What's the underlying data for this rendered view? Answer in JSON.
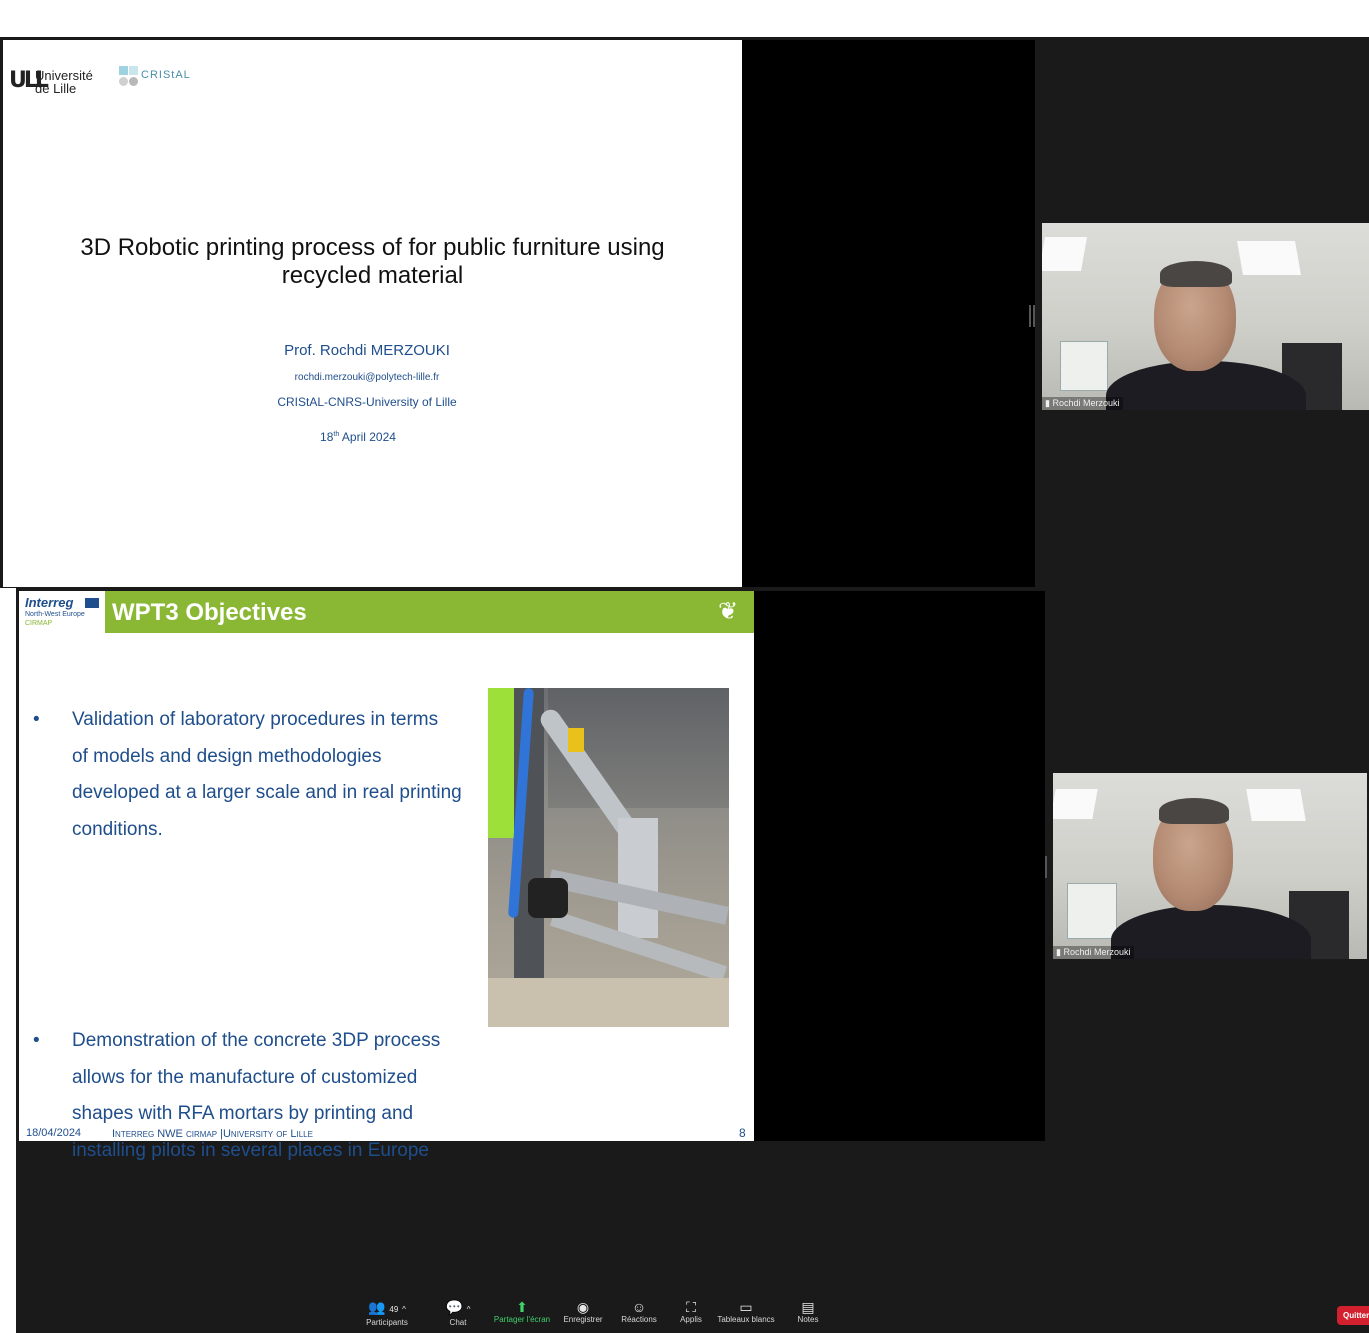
{
  "top_meeting": {
    "slide": {
      "logo_univ_line1": "Université",
      "logo_univ_line2": "de Lille",
      "logo_cristal": "CRIStAL",
      "title_line1": "3D Robotic printing process of for public furniture using",
      "title_line2": "recycled material",
      "author": "Prof. Rochdi MERZOUKI",
      "email": "rochdi.merzouki@polytech-lille.fr",
      "affiliation": "CRIStAL-CNRS-University of Lille",
      "date_day": "18",
      "date_sup": "th",
      "date_rest": "April 2024"
    },
    "participant_name": "Rochdi Merzouki"
  },
  "bottom_meeting": {
    "slide": {
      "logo_interreg": "Interreg",
      "logo_nwe": "North-West Europe",
      "logo_cirmap": "CIRMAP",
      "title": "WPT3 Objectives",
      "bullets": [
        {
          "lines": [
            "Validation of laboratory procedures in terms",
            "of models and design methodologies",
            "developed at a larger scale and in real printing",
            "conditions."
          ]
        },
        {
          "lines": [
            "Demonstration of the concrete 3DP process",
            "allows for the manufacture of customized",
            "shapes with RFA mortars by printing and",
            "installing pilots in several places in Europe"
          ]
        }
      ],
      "footer_date": "18/04/2024",
      "footer_org": "Interreg NWE cirmap |University of Lille",
      "page_number": "8"
    },
    "participant_name": "Rochdi Merzouki",
    "toolbar": {
      "participants_label": "Participants",
      "participants_count": "49",
      "chat_label": "Chat",
      "share_label": "Partager l'écran",
      "record_label": "Enregistrer",
      "reactions_label": "Réactions",
      "apps_label": "Applis",
      "whiteboards_label": "Tableaux blancs",
      "notes_label": "Notes",
      "quit_label": "Quitter"
    }
  },
  "colors": {
    "slide_blue": "#1f4e8c",
    "slide_green": "#8ab734",
    "share_green": "#3fd16b",
    "quit_red": "#d3202e"
  }
}
